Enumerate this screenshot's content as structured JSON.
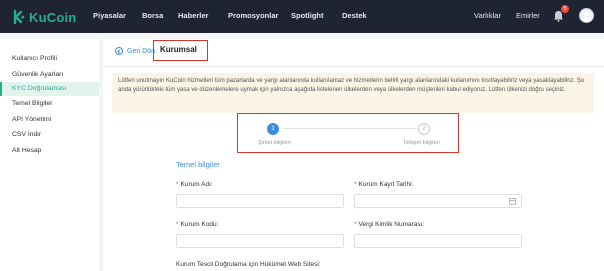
{
  "brand": {
    "name": "KuCoin",
    "accent": "#23af91"
  },
  "topnav": {
    "items": [
      "Piyasalar",
      "Borsa",
      "Haberler",
      "Promosyonlar",
      "Spotlight",
      "Destek"
    ],
    "right": {
      "assets": "Varlıklar",
      "orders": "Emirler",
      "notification_count": "5"
    }
  },
  "sidebar": {
    "items": [
      {
        "label": "Kullanıcı Profili",
        "active": false
      },
      {
        "label": "Güvenlik Ayarları",
        "active": false
      },
      {
        "label": "KYC Doğrulaması",
        "active": true
      },
      {
        "label": "Temel Bilgiler",
        "active": false
      },
      {
        "label": "API Yönetimi",
        "active": false
      },
      {
        "label": "CSV İndir",
        "active": false
      },
      {
        "label": "Alt Hesap",
        "active": false
      }
    ]
  },
  "header": {
    "back_label": "Geri Dön",
    "title": "Kurumsal"
  },
  "notice": "Lütfen unutmayın KuCoin hizmetleri tüm pazarlarda ve yargı alanlarında kullanılamaz ve hizmetlerin belirli yargı alanlarındaki kullanımını kısıtlayabiliriz veya yasaklayabiliriz. Şu anda yürürlükteki tüm yasa ve düzenlemelere uymak için yalnızca aşağıda listelenen ülkelerden veya ülkelerden müşterileri kabul ediyoruz. Lütfen ülkenizi doğru seçiniz.",
  "steps": [
    {
      "number": "1",
      "label": "Şirket bilgileri",
      "active": true
    },
    {
      "number": "2",
      "label": "İletişim bilgileri",
      "active": false
    }
  ],
  "form": {
    "section_title": "Temel bilgiler",
    "required_mark": "*",
    "institution_name": {
      "label": "Kurum Adı:",
      "value": ""
    },
    "registration_date": {
      "label": "Kurum Kayıt Tarihi:",
      "value": ""
    },
    "institution_code": {
      "label": "Kurum Kodu:",
      "value": ""
    },
    "tax_number": {
      "label": "Vergi Kimlik Numarası:",
      "value": ""
    },
    "gov_website": {
      "label": "Kurum Tescil Doğrulama için Hükümet Web Sitesi:"
    }
  }
}
